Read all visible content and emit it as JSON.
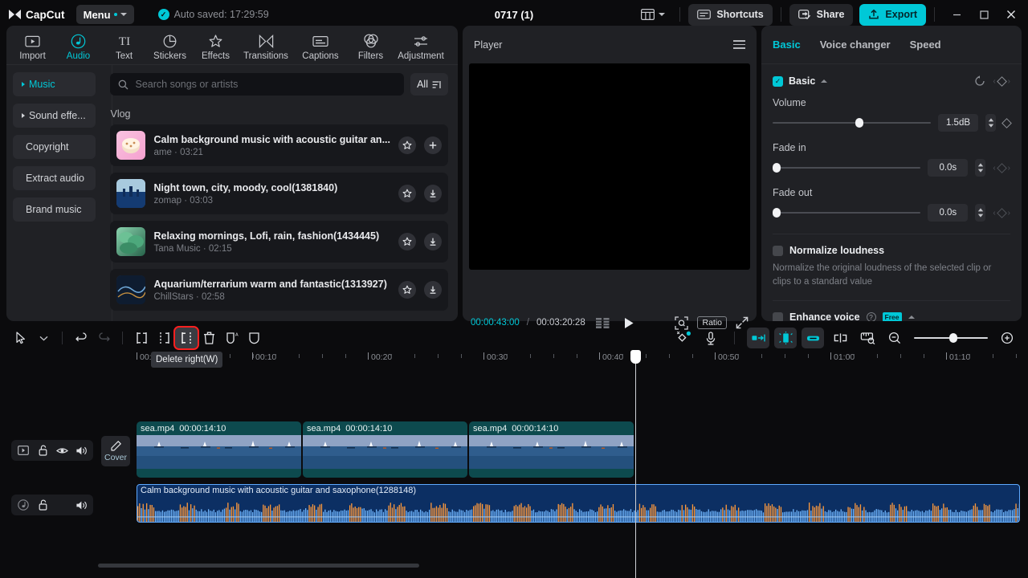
{
  "titlebar": {
    "app_name": "CapCut",
    "menu_label": "Menu",
    "autosave_text": "Auto saved: 17:29:59",
    "project_title": "0717 (1)",
    "shortcuts_label": "Shortcuts",
    "share_label": "Share",
    "export_label": "Export",
    "accent_color": "#00c8d7",
    "icons": {
      "layout": "layout-icon",
      "caret": "chevron-down-icon",
      "minimize": "minimize-icon",
      "maximize": "maximize-icon",
      "close": "close-icon"
    }
  },
  "tooltabs": [
    {
      "label": "Import",
      "icon": "import-icon",
      "active": false
    },
    {
      "label": "Audio",
      "icon": "audio-note-icon",
      "active": true
    },
    {
      "label": "Text",
      "icon": "text-icon",
      "active": false
    },
    {
      "label": "Stickers",
      "icon": "sticker-icon",
      "active": false
    },
    {
      "label": "Effects",
      "icon": "effects-star-icon",
      "active": false
    },
    {
      "label": "Transitions",
      "icon": "transitions-icon",
      "active": false
    },
    {
      "label": "Captions",
      "icon": "captions-icon",
      "active": false
    },
    {
      "label": "Filters",
      "icon": "filters-icon",
      "active": false
    },
    {
      "label": "Adjustment",
      "icon": "adjustment-sliders-icon",
      "active": false
    }
  ],
  "categories": [
    {
      "label": "Music",
      "expandable": true,
      "active": true
    },
    {
      "label": "Sound effe...",
      "expandable": true,
      "active": false
    },
    {
      "label": "Copyright",
      "expandable": false,
      "active": false
    },
    {
      "label": "Extract audio",
      "expandable": false,
      "active": false
    },
    {
      "label": "Brand music",
      "expandable": false,
      "active": false
    }
  ],
  "search": {
    "placeholder": "Search songs or artists",
    "value": "",
    "filter_label": "All"
  },
  "music": {
    "section_label": "Vlog",
    "songs": [
      {
        "title": "Calm background music with acoustic guitar an...",
        "artist": "ame",
        "duration": "03:21",
        "action": "add",
        "thumb_a": "#f6b8d8",
        "thumb_b": "#fce3c8"
      },
      {
        "title": "Night town, city, moody, cool(1381840)",
        "artist": "zomap",
        "duration": "03:03",
        "action": "download",
        "thumb_a": "#9fc8da",
        "thumb_b": "#1d4f86"
      },
      {
        "title": "Relaxing mornings, Lofi, rain, fashion(1434445)",
        "artist": "Tana Music",
        "duration": "02:15",
        "action": "download",
        "thumb_a": "#7fc9a8",
        "thumb_b": "#2b6b4f"
      },
      {
        "title": "Aquarium/terrarium warm and fantastic(1313927)",
        "artist": "ChillStars",
        "duration": "02:58",
        "action": "download",
        "thumb_a": "#2a4668",
        "thumb_b": "#0d1a2c"
      }
    ]
  },
  "player": {
    "header": "Player",
    "current_time": "00:00:43:00",
    "separator": "/",
    "total_time": "00:03:20:28",
    "ratio_label": "Ratio",
    "icons": {
      "menu": "hamburger-icon",
      "frames": "frames-icon",
      "play": "play-icon",
      "zoom": "zoom-fit-icon",
      "fullscreen": "fullscreen-icon"
    }
  },
  "properties": {
    "tabs": [
      {
        "label": "Basic",
        "active": true
      },
      {
        "label": "Voice changer",
        "active": false
      },
      {
        "label": "Speed",
        "active": false
      }
    ],
    "section_title": "Basic",
    "section_checked": true,
    "volume": {
      "label": "Volume",
      "value": "1.5dB",
      "slider_pct": 55
    },
    "fade_in": {
      "label": "Fade in",
      "value": "0.0s",
      "slider_pct": 0
    },
    "fade_out": {
      "label": "Fade out",
      "value": "0.0s",
      "slider_pct": 0
    },
    "normalize": {
      "label": "Normalize loudness",
      "checked": false,
      "description": "Normalize the original loudness of the selected clip or clips to a standard value"
    },
    "enhance_voice": {
      "label": "Enhance voice",
      "checked": false,
      "badge": "Free"
    },
    "icons": {
      "reset": "reset-icon",
      "keyframe": "keyframe-diamond-icon"
    }
  },
  "timeline_toolbar": {
    "left_tools": [
      {
        "name": "select-tool",
        "icon": "cursor-icon",
        "selected": false
      },
      {
        "name": "select-dropdown",
        "icon": "chevron-down-icon",
        "selected": false
      },
      {
        "name": "undo",
        "icon": "undo-icon",
        "selected": false
      },
      {
        "name": "redo",
        "icon": "redo-icon",
        "selected": false
      },
      {
        "name": "split",
        "icon": "split-icon",
        "selected": false
      },
      {
        "name": "delete-left",
        "icon": "delete-left-icon",
        "selected": false
      },
      {
        "name": "delete-right",
        "icon": "delete-right-icon",
        "selected": true
      },
      {
        "name": "delete",
        "icon": "trash-icon",
        "selected": false
      },
      {
        "name": "ai-mask",
        "icon": "ai-shield-icon",
        "selected": false
      },
      {
        "name": "mask",
        "icon": "shield-icon",
        "selected": false
      }
    ],
    "tooltip": "Delete right(W)",
    "right_tools": [
      {
        "name": "auto-effects",
        "icon": "magic-wand-icon",
        "accent": false
      },
      {
        "name": "record-voiceover",
        "icon": "microphone-icon",
        "accent": false
      },
      {
        "name": "auto-cut",
        "icon": "auto-cut-icon",
        "accent": true
      },
      {
        "name": "smart-edit",
        "icon": "smart-edit-icon",
        "accent": true
      },
      {
        "name": "link-clip",
        "icon": "link-clip-icon",
        "accent": true
      },
      {
        "name": "align-clip",
        "icon": "align-icon",
        "accent": false
      },
      {
        "name": "measure",
        "icon": "ruler-icon",
        "accent": false
      }
    ],
    "zoom": {
      "out_icon": "zoom-out-icon",
      "in_icon": "zoom-in-icon",
      "value_pct": 48
    }
  },
  "timeline": {
    "ruler_labels": [
      "00:00",
      "00:10",
      "00:20",
      "00:30",
      "00:40",
      "00:50",
      "01:00",
      "01:10"
    ],
    "playhead_time": "00:00:43:00",
    "video_track": {
      "cover_label": "Cover",
      "icons": [
        "video-track-icon",
        "lock-icon",
        "eye-icon",
        "volume-icon"
      ],
      "clips": [
        {
          "name": "sea.mp4",
          "duration": "00:00:14:10"
        },
        {
          "name": "sea.mp4",
          "duration": "00:00:14:10"
        },
        {
          "name": "sea.mp4",
          "duration": "00:00:14:10"
        }
      ]
    },
    "audio_track": {
      "icons": [
        "audio-track-icon",
        "lock-icon",
        "blank-icon",
        "volume-icon"
      ],
      "clip": {
        "name": "Calm background music with acoustic guitar and saxophone(1288148)"
      }
    }
  }
}
